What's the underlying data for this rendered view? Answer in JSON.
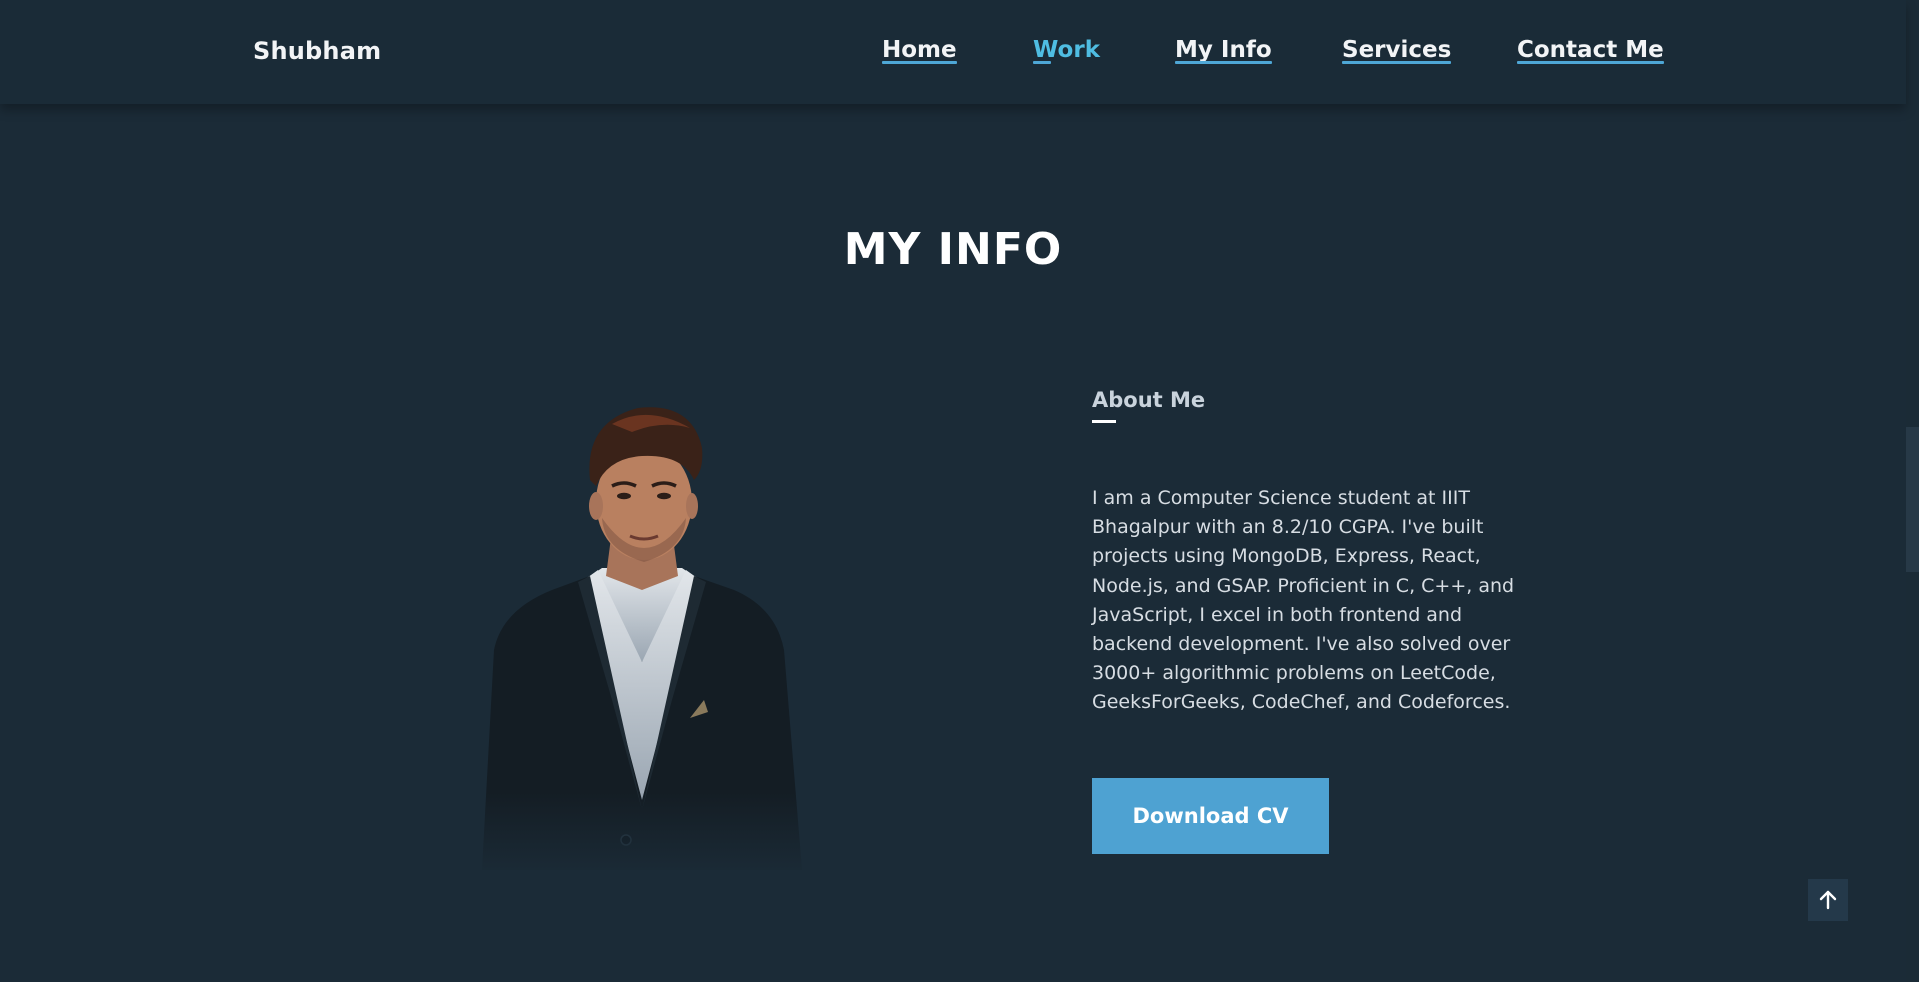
{
  "header": {
    "brand": "Shubham",
    "nav": [
      {
        "label": "Home",
        "active": false
      },
      {
        "label": "Work",
        "active": true
      },
      {
        "label": "My Info",
        "active": false
      },
      {
        "label": "Services",
        "active": false
      },
      {
        "label": "Contact Me",
        "active": false
      }
    ]
  },
  "main": {
    "title": "MY INFO",
    "about_heading": "About Me",
    "about_text": "I am a Computer Science student at IIIT Bhagalpur with an 8.2/10 CGPA. I've built projects using MongoDB, Express, React, Node.js, and GSAP. Proficient in C, C++, and JavaScript, I excel in both frontend and backend development. I've also solved over 3000+ algorithmic problems on LeetCode, GeeksForGeeks, CodeChef, and Codeforces.",
    "cv_button": "Download CV"
  },
  "icons": {
    "scroll_top": "arrow-up-icon"
  },
  "colors": {
    "background": "#1b2b37",
    "accent": "#4ea2d2",
    "active_nav": "#4fbde2"
  }
}
